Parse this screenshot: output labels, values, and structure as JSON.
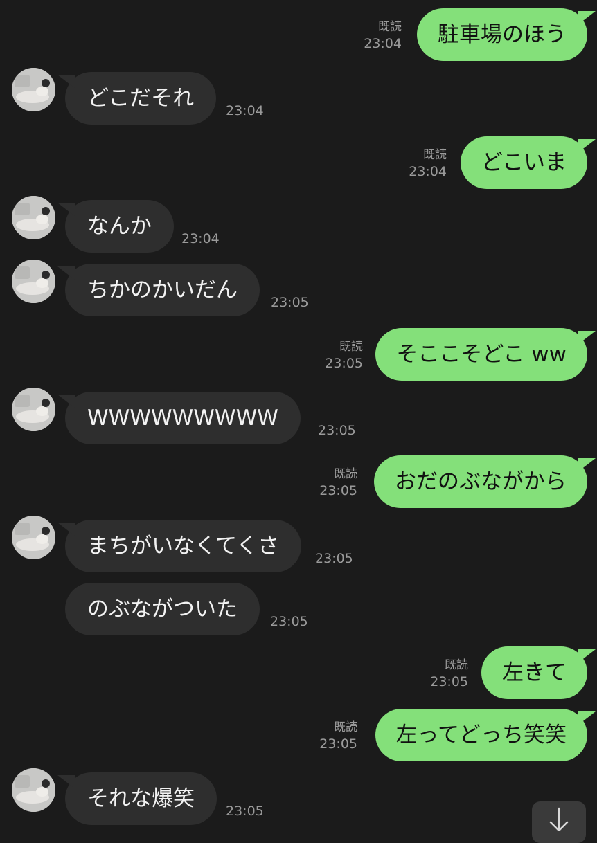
{
  "messages": [
    {
      "side": "me",
      "text": "駐車場のほう",
      "read": "既読",
      "time": "23:04"
    },
    {
      "side": "them",
      "text": "どこだそれ",
      "time": "23:04",
      "avatar": true
    },
    {
      "side": "me",
      "text": "どこいま",
      "read": "既読",
      "time": "23:04"
    },
    {
      "side": "them",
      "text": "なんか",
      "time": "23:04",
      "avatar": true
    },
    {
      "side": "them",
      "text": "ちかのかいだん",
      "time": "23:05",
      "avatar": true
    },
    {
      "side": "me",
      "text": "そここそどこ ww",
      "read": "既読",
      "time": "23:05"
    },
    {
      "side": "them",
      "text": "WWWWWWWWW",
      "time": "23:05",
      "avatar": true
    },
    {
      "side": "me",
      "text": "おだのぶながから",
      "read": "既読",
      "time": "23:05"
    },
    {
      "side": "them",
      "text": "まちがいなくてくさ",
      "time": "23:05",
      "avatar": true
    },
    {
      "side": "them",
      "text": "のぶながついた",
      "time": "23:05",
      "avatar": false
    },
    {
      "side": "me",
      "text": "左きて",
      "read": "既読",
      "time": "23:05"
    },
    {
      "side": "me",
      "text": "左ってどっち笑笑",
      "read": "既読",
      "time": "23:05"
    },
    {
      "side": "them",
      "text": "それな爆笑",
      "time": "23:05",
      "avatar": true
    }
  ],
  "scroll_button": {
    "icon": "arrow-down-icon"
  }
}
